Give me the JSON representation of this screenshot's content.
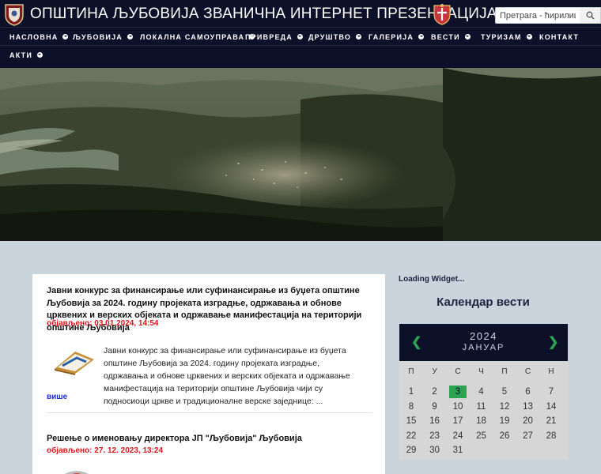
{
  "header": {
    "title": "ОПШТИНА ЉУБОВИЈА ЗВАНИЧНА ИНТЕРНЕТ ПРЕЗЕНТАЦИЈА",
    "search_placeholder": "Претрага - ћирилица"
  },
  "nav": {
    "items": [
      {
        "label": "НАСЛОВНА",
        "dropdown": true
      },
      {
        "label": "ЉУБОВИЈА",
        "dropdown": true
      },
      {
        "label": "ЛОКАЛНА САМОУПРАВА",
        "dropdown": true
      },
      {
        "label": "ПРИВРЕДА",
        "dropdown": true
      },
      {
        "label": "ДРУШТВО",
        "dropdown": true
      },
      {
        "label": "ГАЛЕРИЈА",
        "dropdown": true
      },
      {
        "label": "ВЕСТИ",
        "dropdown": true
      },
      {
        "label": "ТУРИЗАМ",
        "dropdown": true
      },
      {
        "label": "КОНТАКТ",
        "dropdown": false
      },
      {
        "label": "АКТИ",
        "dropdown": true
      }
    ]
  },
  "news": {
    "items": [
      {
        "title": "Јавни конкурс за финансирање или суфинансирање из буџета општине Љубовија за 2024. годину пројеката изградње, одржавања и обнове црквених и верских објеката и одржавање манифестација на територији општине Љубовија",
        "date": "објављено: 03.01.2024, 14:54",
        "text": "Јавни конкурс за финансирање или суфинансирање из буџета општине Љубовија за 2024. годину пројеката изградње, одржавања и обнове црквених и верских објеката и одржавање манифестација на територији општине Љубовија чији су подносиоци цркве и традиционалне верске заједнице: ...",
        "more": "више"
      },
      {
        "title": "Решење о именовању директора ЈП \"Љубовија\" Љубовија",
        "date": "објављено: 27. 12. 2023, 13:24"
      }
    ]
  },
  "sidebar": {
    "loading": "Loading Widget...",
    "calendar_heading": "Календар вести"
  },
  "calendar": {
    "year": "2024",
    "month": "ЈАНУАР",
    "prev": "❮",
    "next": "❯",
    "weekdays": [
      "П",
      "У",
      "С",
      "Ч",
      "П",
      "С",
      "Н"
    ],
    "first_weekday_index": 0,
    "days_in_month": 31,
    "today": 3,
    "accent": "#2aa451"
  },
  "colors": {
    "header_bg": "#0c1028",
    "page_bg": "#c9d4dc",
    "date_red": "#e3141b",
    "link_blue": "#1a2fd0"
  }
}
